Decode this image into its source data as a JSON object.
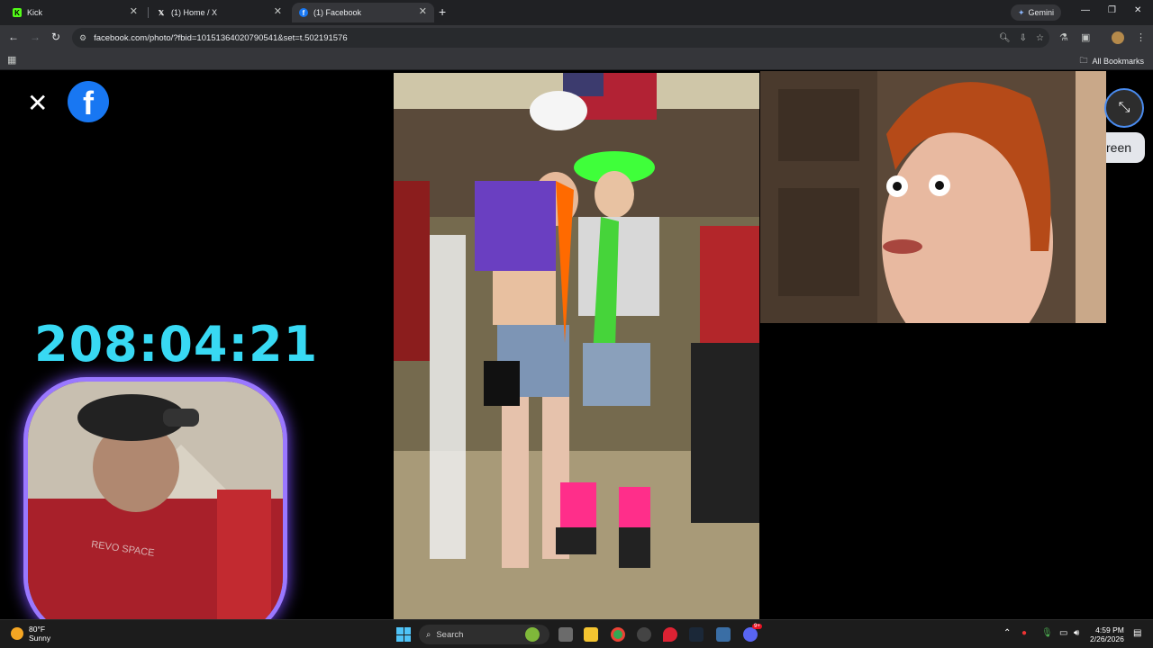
{
  "browser": {
    "tabs": [
      {
        "label": "Kick",
        "favicon": "K",
        "color": "#53fc18"
      },
      {
        "label": "(1) Home / X",
        "favicon": "𝕏",
        "color": "#ffffff"
      },
      {
        "label": "(1) Facebook",
        "favicon": "f",
        "color": "#1877f2"
      }
    ],
    "gemini_label": "Gemini",
    "url": "facebook.com/photo/?fbid=10151364020790541&set=t.502191576",
    "bookmarks_label": "All Bookmarks"
  },
  "viewer": {
    "timer": "208:04:21",
    "fullscreen_tip": "reen",
    "webcam_shirt_text": "REVO  SPACE"
  },
  "taskbar": {
    "weather_temp": "80°F",
    "weather_cond": "Sunny",
    "search_placeholder": "Search",
    "time": "4:59 PM",
    "date": "2/26/2026",
    "discord_badge": "9+"
  },
  "colors": {
    "timer": "#38d9f3",
    "facebook_blue": "#1877f2",
    "webcam_border": "#9a78ff"
  }
}
